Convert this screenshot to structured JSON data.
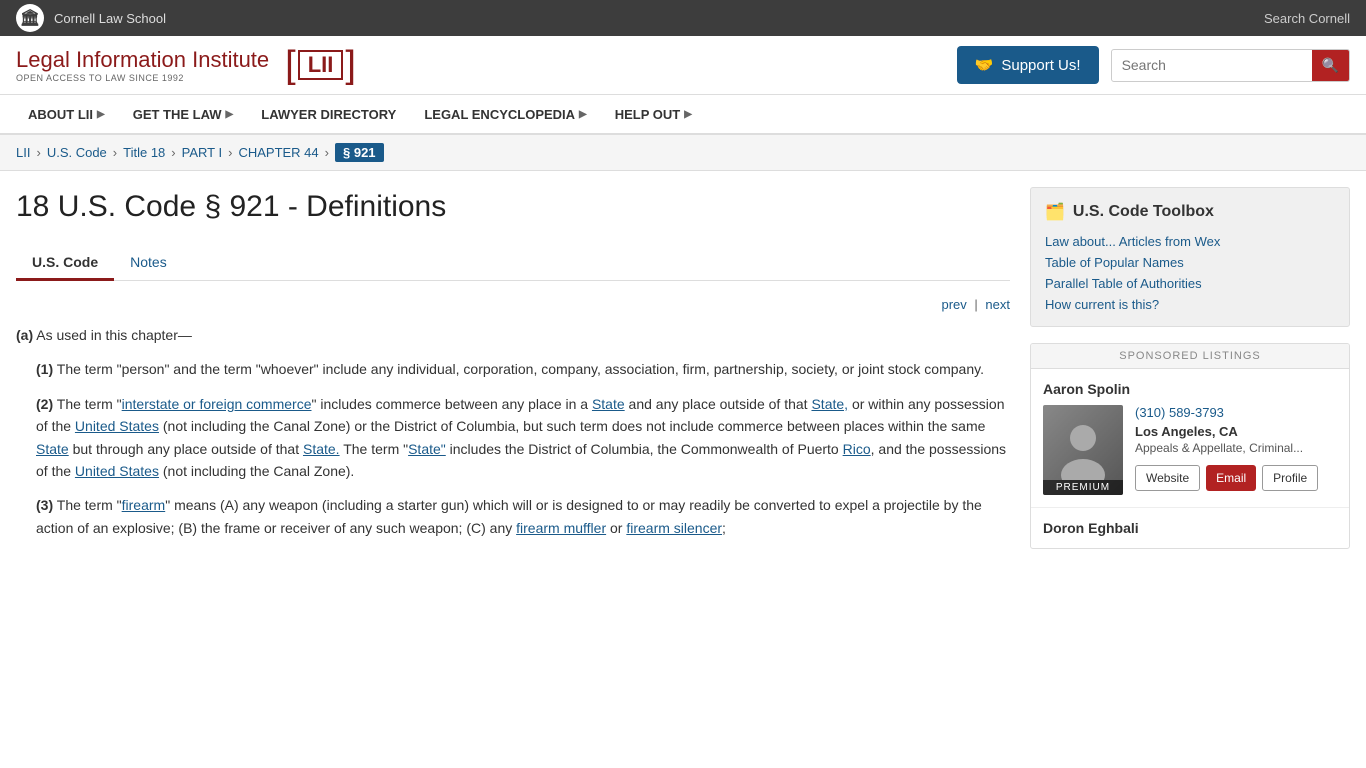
{
  "topbar": {
    "school": "Cornell Law School",
    "search_cornell": "Search Cornell",
    "logo_char": "🏛"
  },
  "header": {
    "lii_main": "Legal Information Institute",
    "lii_bracket": "LII",
    "lii_sub": "OPEN ACCESS TO LAW SINCE 1992",
    "support_label": "Support Us!",
    "search_placeholder": "Search"
  },
  "nav": {
    "items": [
      {
        "label": "ABOUT LII",
        "has_arrow": true
      },
      {
        "label": "GET THE LAW",
        "has_arrow": true
      },
      {
        "label": "LAWYER DIRECTORY",
        "has_arrow": false
      },
      {
        "label": "LEGAL ENCYCLOPEDIA",
        "has_arrow": true
      },
      {
        "label": "HELP OUT",
        "has_arrow": true
      }
    ]
  },
  "breadcrumb": {
    "items": [
      {
        "label": "LII",
        "href": true
      },
      {
        "label": "U.S. Code",
        "href": true
      },
      {
        "label": "Title 18",
        "href": true
      },
      {
        "label": "PART I",
        "href": true
      },
      {
        "label": "CHAPTER 44",
        "href": true
      },
      {
        "label": "§ 921",
        "current": true
      }
    ]
  },
  "page": {
    "title": "18 U.S. Code § 921 - Definitions",
    "tabs": [
      {
        "label": "U.S. Code",
        "active": true
      },
      {
        "label": "Notes",
        "active": false
      }
    ],
    "prev_label": "prev",
    "next_label": "next",
    "content": {
      "section_a_label": "(a)",
      "section_a_intro": "As used in this chapter—",
      "subsections": [
        {
          "num": "(1)",
          "text": "The term “person” and the term “whoever” include any individual, corporation, company, association, firm, partnership, society, or joint stock company."
        },
        {
          "num": "(2)",
          "text_parts": [
            {
              "type": "text",
              "content": "The term “"
            },
            {
              "type": "link",
              "content": "interstate or foreign commerce"
            },
            {
              "type": "text",
              "content": "” includes commerce between any place in a "
            },
            {
              "type": "link",
              "content": "State"
            },
            {
              "type": "text",
              "content": " and any place outside of that "
            },
            {
              "type": "link",
              "content": "State,"
            },
            {
              "type": "text",
              "content": " or within any possession of the "
            },
            {
              "type": "link",
              "content": "United States"
            },
            {
              "type": "text",
              "content": " (not including the Canal Zone) or the District of Columbia, but such term does not include commerce between places within the same "
            },
            {
              "type": "link",
              "content": "State"
            },
            {
              "type": "text",
              "content": " but through any place outside of that "
            },
            {
              "type": "link",
              "content": "State."
            },
            {
              "type": "text",
              "content": " The term “"
            },
            {
              "type": "link",
              "content": "State”"
            },
            {
              "type": "text",
              "content": " includes the District of Columbia, the Commonwealth of Puerto "
            },
            {
              "type": "link",
              "content": "Rico"
            },
            {
              "type": "text",
              "content": ", and the possessions of the "
            },
            {
              "type": "link",
              "content": "United States"
            },
            {
              "type": "text",
              "content": " (not including the Canal Zone)."
            }
          ]
        },
        {
          "num": "(3)",
          "text_parts": [
            {
              "type": "text",
              "content": "The term “"
            },
            {
              "type": "link",
              "content": "firearm"
            },
            {
              "type": "text",
              "content": "” means (A) any weapon (including a starter gun) which will or is designed to or may readily be converted to expel a projectile by the action of an explosive; (B) the frame or receiver of any such weapon; (C) any "
            },
            {
              "type": "link",
              "content": "firearm muffler"
            },
            {
              "type": "text",
              "content": " or "
            },
            {
              "type": "link",
              "content": "firearm silencer"
            },
            {
              "type": "text",
              "content": ";"
            }
          ]
        }
      ]
    }
  },
  "sidebar": {
    "toolbox_title": "U.S. Code Toolbox",
    "toolbox_links": [
      "Law about... Articles from Wex",
      "Table of Popular Names",
      "Parallel Table of Authorities",
      "How current is this?"
    ],
    "sponsored_header": "SPONSORED LISTINGS",
    "attorneys": [
      {
        "name": "Aaron Spolin",
        "phone": "(310) 589-3793",
        "city": "Los Angeles, CA",
        "practice": "Appeals & Appellate, Criminal...",
        "is_premium": true,
        "premium_label": "PREMIUM",
        "btn_website": "Website",
        "btn_email": "Email",
        "btn_profile": "Profile"
      },
      {
        "name": "Doron Eghbali",
        "phone": "",
        "city": "",
        "practice": ""
      }
    ]
  }
}
